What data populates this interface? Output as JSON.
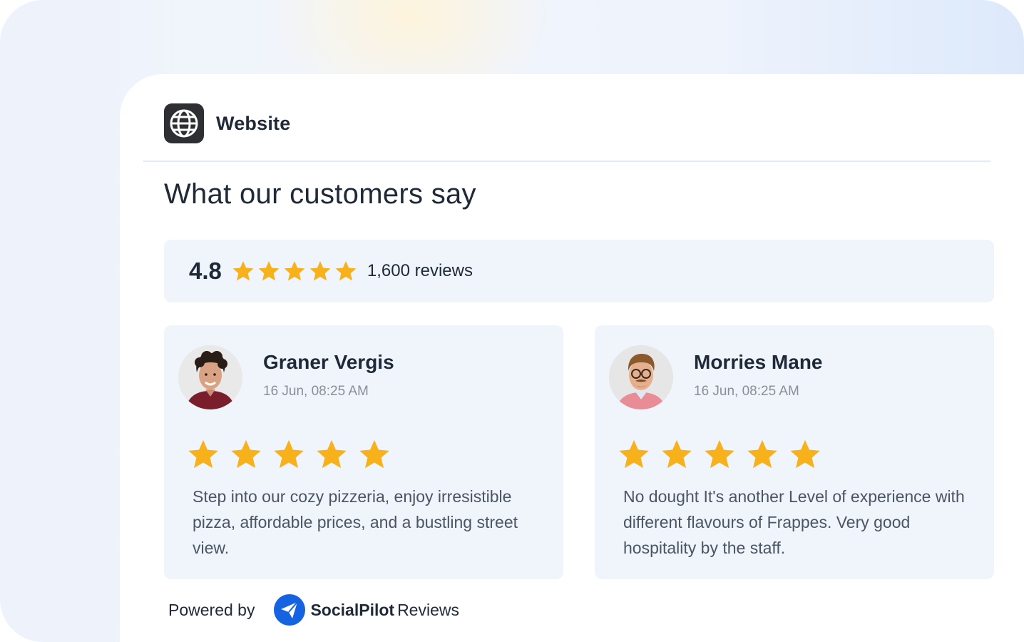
{
  "header": {
    "title": "Website",
    "icon": "globe-icon"
  },
  "page": {
    "title": "What our customers say"
  },
  "summary": {
    "score": "4.8",
    "stars": 5,
    "count_label": "1,600 reviews"
  },
  "reviews": [
    {
      "name": "Graner Vergis",
      "time": "16 Jun, 08:25 AM",
      "stars": 5,
      "text": "Step into our cozy pizzeria, enjoy irresistible pizza, affordable prices, and a bustling street view."
    },
    {
      "name": "Morries Mane",
      "time": "16 Jun, 08:25 AM",
      "stars": 5,
      "text": "No dought It's another Level of experience with different flavours of Frappes. Very good hospitality by the staff."
    }
  ],
  "footer": {
    "powered_label": "Powered by",
    "brand": "SocialPilot",
    "product": "Reviews"
  },
  "colors": {
    "star": "#f6b11b",
    "panel": "#f0f4fb",
    "icon_bg": "#2d2f33",
    "logo_blue": "#1563e0"
  }
}
